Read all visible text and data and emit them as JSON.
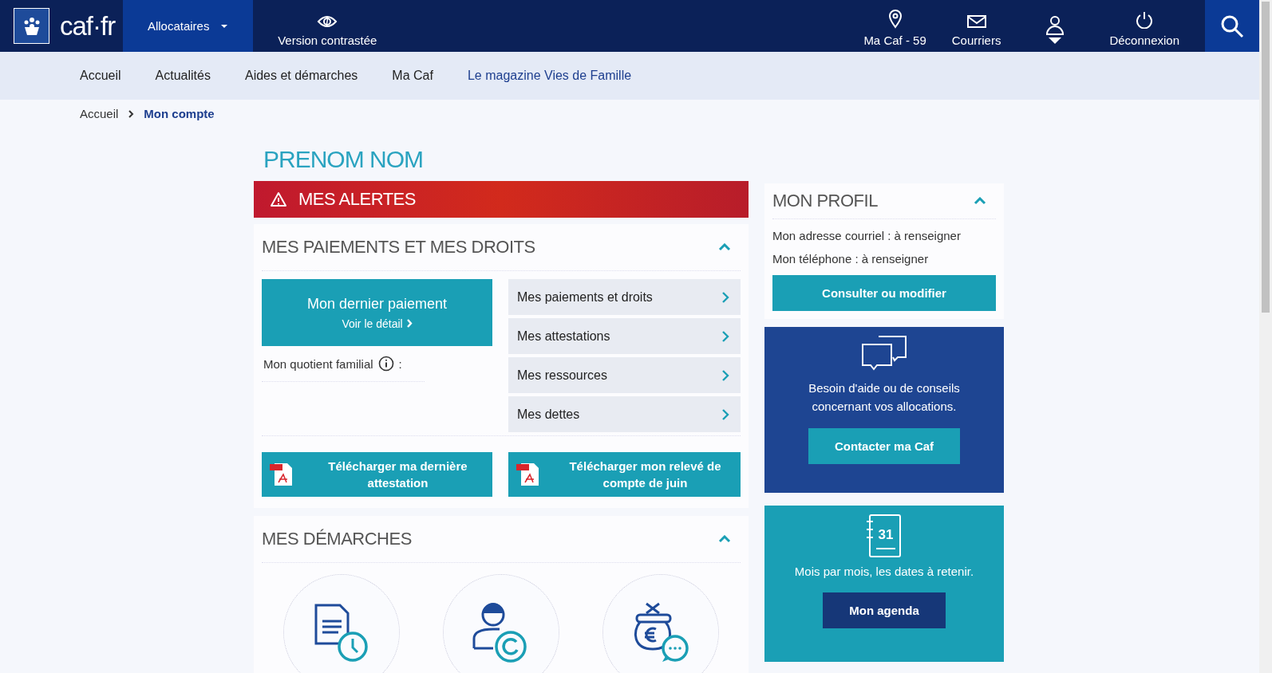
{
  "header": {
    "logo_text": "caf·fr",
    "audience_menu": {
      "label": "Allocataires",
      "selected": true
    },
    "contrast": "Version contrastée",
    "actions": [
      {
        "kind": "location",
        "label": "Ma Caf - 59"
      },
      {
        "kind": "mail",
        "label": "Courriers"
      },
      {
        "kind": "account"
      },
      {
        "kind": "logout",
        "label": "Déconnexion"
      }
    ]
  },
  "nav": [
    {
      "label": "Accueil",
      "highlighted": false
    },
    {
      "label": "Actualités",
      "highlighted": false
    },
    {
      "label": "Aides et démarches",
      "highlighted": false
    },
    {
      "label": "Ma Caf",
      "highlighted": false
    },
    {
      "label": "Le magazine Vies de Famille",
      "highlighted": true
    }
  ],
  "breadcrumb": [
    {
      "label": "Accueil",
      "selected": false
    },
    {
      "label": "Mon compte",
      "selected": true
    }
  ],
  "user_name": "PRENOM NOM",
  "alerts": {
    "title": "MES ALERTES"
  },
  "payments": {
    "title": "MES PAIEMENTS ET MES DROITS",
    "expanded": true,
    "last_payment": {
      "title": "Mon dernier paiement",
      "link": "Voir le détail"
    },
    "quotient": "Mon quotient familial",
    "quotient_suffix": ":",
    "links": [
      "Mes paiements et droits",
      "Mes attestations",
      "Mes ressources",
      "Mes dettes"
    ],
    "downloads": [
      "Télécharger ma dernière attestation",
      "Télécharger mon relevé de compte de juin"
    ]
  },
  "procedures": {
    "title": "MES DÉMARCHES",
    "expanded": true,
    "items": [
      {
        "kind": "document-clock"
      },
      {
        "kind": "person-refresh"
      },
      {
        "kind": "money-bag-chat"
      }
    ]
  },
  "profile": {
    "title": "MON PROFIL",
    "expanded": true,
    "fields": [
      "Mon adresse courriel : à renseigner",
      "Mon téléphone : à renseigner"
    ],
    "button": "Consulter ou modifier"
  },
  "help": {
    "text": "Besoin d'aide ou de conseils concernant vos allocations.",
    "button": "Contacter ma Caf"
  },
  "agenda": {
    "day": "31",
    "text": "Mois par mois, les dates à retenir.",
    "button": "Mon agenda"
  }
}
